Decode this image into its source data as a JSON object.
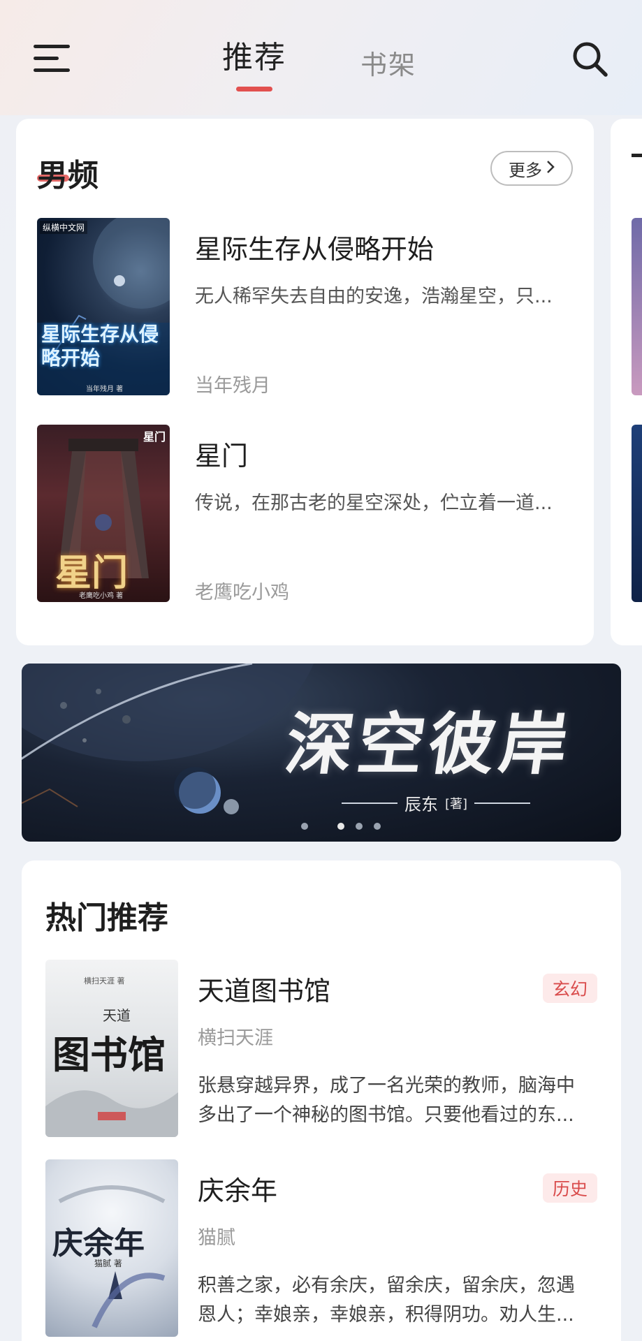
{
  "header": {
    "tabs": [
      {
        "label": "推荐",
        "active": true
      },
      {
        "label": "书架",
        "active": false
      }
    ],
    "accent_color": "#e2504f",
    "left_icon": "menu-icon",
    "right_icon": "search-icon"
  },
  "male_section": {
    "title": "男频",
    "more_label": "更多",
    "books": [
      {
        "title": "星际生存从侵略开始",
        "desc": "无人稀罕失去自由的安逸，浩瀚星空，只...",
        "author": "当年残月",
        "cover": {
          "publisher": "纵横中文网",
          "cover_title": "星际生存从侵略开始",
          "cover_author": "当年残月 著"
        }
      },
      {
        "title": "星门",
        "desc": "传说，在那古老的星空深处，伫立着一道...",
        "author": "老鹰吃小鸡",
        "cover": {
          "publisher": "星门",
          "cover_title": "星门",
          "cover_author": "老鹰吃小鸡 著"
        }
      }
    ]
  },
  "banner": {
    "title": "深空彼岸",
    "author": "辰东",
    "author_suffix": "[著]",
    "dot_count": 4,
    "active_dot": 1
  },
  "hot_section": {
    "title": "热门推荐",
    "books": [
      {
        "title": "天道图书馆",
        "author": "横扫天涯",
        "tag": "玄幻",
        "desc": "张悬穿越异界，成了一名光荣的教师，脑海中多出了一个神秘的图书馆。只要他看过的东...",
        "cover": {
          "cover_title": "图书馆",
          "cover_sub": "天道",
          "cover_author": "横扫天涯 著"
        }
      },
      {
        "title": "庆余年",
        "author": "猫腻",
        "tag": "历史",
        "desc": "积善之家，必有余庆，留余庆，留余庆，忽遇恩人；幸娘亲，幸娘亲，积得阴功。劝人生...",
        "cover": {
          "cover_title": "庆余年",
          "cover_author": "猫腻 著"
        }
      }
    ]
  }
}
